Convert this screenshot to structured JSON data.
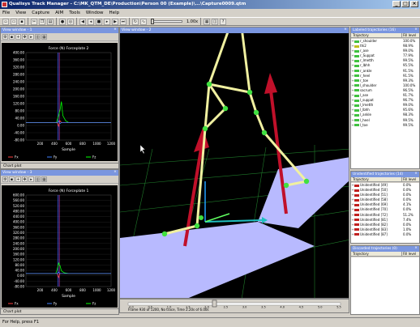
{
  "window": {
    "title": "Qualisys Track Manager - C:\\MK_QTM_DE\\Production\\Person 00 (Example)\\...\\Capture0009.qtm"
  },
  "menu": [
    "File",
    "View",
    "Capture",
    "AIM",
    "Tools",
    "Window",
    "Help"
  ],
  "toolbar": {
    "zoom_value": "1.00x"
  },
  "left_views": [
    {
      "title": "View window - 1",
      "chart_title": "Force (N) Forceplate 2",
      "footer": "Chart plot",
      "legend": [
        "Fx",
        "Fy",
        "Fz"
      ]
    },
    {
      "title": "View window - 3",
      "chart_title": "Force (N) Forceplate 1",
      "footer": "Chart plot",
      "legend": [
        "Fx",
        "Fy",
        "Fz"
      ]
    }
  ],
  "chart_data": [
    {
      "type": "line",
      "title": "Force (N) Forceplate 2",
      "xlabel": "Sample",
      "ylabel": "",
      "xlim": [
        0,
        1200
      ],
      "ylim": [
        -100,
        400
      ],
      "xticks": [
        "200",
        "400",
        "600",
        "800",
        "1000",
        "1200"
      ],
      "yticks": [
        "400.00",
        "360.00",
        "320.00",
        "280.00",
        "240.00",
        "200.00",
        "160.00",
        "120.00",
        "80.00",
        "40.00",
        "0.00",
        "-40.00",
        "-80.00"
      ],
      "series": [
        {
          "name": "Fz",
          "color": "#00ff00",
          "x": [
            0,
            400,
            430,
            460,
            480,
            500,
            520,
            560,
            600,
            1200
          ],
          "y": [
            0,
            0,
            0,
            40,
            70,
            120,
            40,
            10,
            0,
            0
          ]
        },
        {
          "name": "Fx",
          "color": "#ff4040",
          "x": [
            0,
            440,
            460,
            480,
            500,
            1200
          ],
          "y": [
            0,
            0,
            -20,
            10,
            0,
            0
          ]
        },
        {
          "name": "Fy",
          "color": "#4080ff",
          "x": [
            0,
            440,
            460,
            480,
            500,
            1200
          ],
          "y": [
            0,
            0,
            8,
            -6,
            0,
            0
          ]
        }
      ]
    },
    {
      "type": "line",
      "title": "Force (N) Forceplate 1",
      "xlabel": "Sample",
      "ylabel": "",
      "xlim": [
        0,
        1200
      ],
      "ylim": [
        -100,
        600
      ],
      "xticks": [
        "200",
        "400",
        "600",
        "800",
        "1000",
        "1200"
      ],
      "yticks": [
        "600.00",
        "560.00",
        "520.00",
        "480.00",
        "440.00",
        "400.00",
        "360.00",
        "320.00",
        "280.00",
        "240.00",
        "200.00",
        "160.00",
        "120.00",
        "80.00",
        "40.00",
        "0.00",
        "-40.00",
        "-80.00"
      ],
      "series": [
        {
          "name": "Fz",
          "color": "#00ff00",
          "x": [
            0,
            420,
            440,
            460,
            480,
            500,
            540,
            600,
            1200
          ],
          "y": [
            0,
            0,
            30,
            80,
            60,
            20,
            5,
            0,
            0
          ]
        },
        {
          "name": "Fx",
          "color": "#ff4040",
          "x": [
            0,
            440,
            460,
            480,
            1200
          ],
          "y": [
            0,
            0,
            -30,
            0,
            0
          ]
        },
        {
          "name": "Fy",
          "color": "#4080ff",
          "x": [
            0,
            440,
            460,
            480,
            1200
          ],
          "y": [
            0,
            0,
            10,
            0,
            0
          ]
        }
      ]
    }
  ],
  "view3d": {
    "title": "View window - 2",
    "timeline_text": "Frame 930 of 1200, No trace, Time 2.20s of 6.00s"
  },
  "timeline_ticks": [
    "0.0",
    "0.5",
    "1.0",
    "1.5",
    "2.0",
    "2.5",
    "3.0",
    "3.5",
    "4.0",
    "4.5",
    "5.0",
    "5.5"
  ],
  "labeled": {
    "title": "Labeled trajectories (16)",
    "col_traj": "Trajectory",
    "col_fill": "Fill level",
    "rows": [
      {
        "name": "r_shoulder",
        "fill": "100.0%",
        "color": "#40c040"
      },
      {
        "name": "thi2",
        "fill": "98.9%",
        "color": "#c0c020"
      },
      {
        "name": "r_ase",
        "fill": "99.0%",
        "color": "#40c040"
      },
      {
        "name": "r_Suppat",
        "fill": "77.9%",
        "color": "#40c040"
      },
      {
        "name": "r_lmetth",
        "fill": "99.5%",
        "color": "#40c040"
      },
      {
        "name": "r_lbhh",
        "fill": "95.5%",
        "color": "#40c040"
      },
      {
        "name": "r_ankle",
        "fill": "91.5%",
        "color": "#40c040"
      },
      {
        "name": "r_heel",
        "fill": "91.5%",
        "color": "#40c040"
      },
      {
        "name": "r_toe",
        "fill": "99.3%",
        "color": "#40c040"
      },
      {
        "name": "l_shoulder",
        "fill": "100.0%",
        "color": "#40c040"
      },
      {
        "name": "sacrum",
        "fill": "96.5%",
        "color": "#40c040"
      },
      {
        "name": "l_ase",
        "fill": "91.7%",
        "color": "#40c040"
      },
      {
        "name": "l_suppat",
        "fill": "96.7%",
        "color": "#40c040"
      },
      {
        "name": "l_lmetth",
        "fill": "99.0%",
        "color": "#40c040"
      },
      {
        "name": "l_lbhh",
        "fill": "95.6%",
        "color": "#40c040"
      },
      {
        "name": "l_ankle",
        "fill": "98.3%",
        "color": "#40c040"
      },
      {
        "name": "l_heel",
        "fill": "99.5%",
        "color": "#40c040"
      },
      {
        "name": "l_toe",
        "fill": "99.5%",
        "color": "#40c040"
      }
    ]
  },
  "unidentified": {
    "title": "Unidentified trajectories (14)",
    "col_traj": "Trajectory",
    "col_fill": "Fill level",
    "rows": [
      {
        "name": "Unidentified [49]",
        "fill": "0.0%",
        "color": "#c02020"
      },
      {
        "name": "Unidentified [50]",
        "fill": "0.0%",
        "color": "#c02020"
      },
      {
        "name": "Unidentified [51]",
        "fill": "0.0%",
        "color": "#c02020"
      },
      {
        "name": "Unidentified [58]",
        "fill": "0.0%",
        "color": "#c02020"
      },
      {
        "name": "Unidentified [69]",
        "fill": "4.1%",
        "color": "#c02020"
      },
      {
        "name": "Unidentified [70]",
        "fill": "0.0%",
        "color": "#c02020"
      },
      {
        "name": "Unidentified [72]",
        "fill": "51.2%",
        "color": "#c02020"
      },
      {
        "name": "Unidentified [81]",
        "fill": "7.4%",
        "color": "#c02020"
      },
      {
        "name": "Unidentified [82]",
        "fill": "0.0%",
        "color": "#c02020"
      },
      {
        "name": "Unidentified [83]",
        "fill": "1.0%",
        "color": "#c02020"
      },
      {
        "name": "Unidentified [87]",
        "fill": "0.0%",
        "color": "#c02020"
      }
    ]
  },
  "discarded": {
    "title": "Discarded trajectories (0)",
    "col_traj": "Trajectory",
    "col_fill": "Fill level"
  },
  "status": {
    "text": "For Help, press F1"
  }
}
